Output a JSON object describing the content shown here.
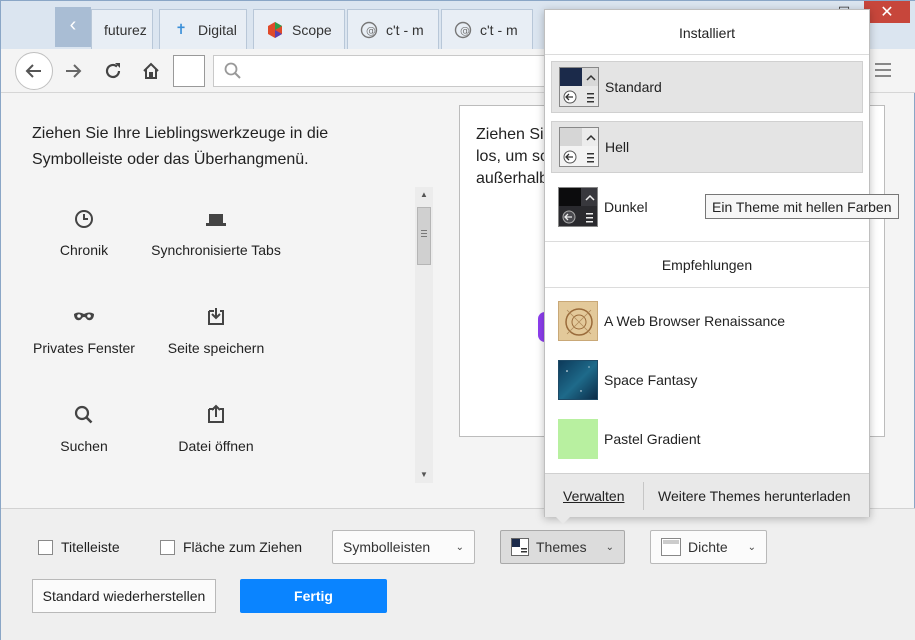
{
  "tabs": [
    {
      "label": "futurez",
      "icon": "future-favicon"
    },
    {
      "label": "Digital",
      "icon": "cross-favicon"
    },
    {
      "label": "Scope",
      "icon": "hexagon-favicon"
    },
    {
      "label": "c't - m",
      "icon": "heise-favicon"
    },
    {
      "label": "c't - m",
      "icon": "heise-favicon"
    }
  ],
  "customize": {
    "intro": "Ziehen Sie Ihre Lieblingswerkzeuge in die Symbolleiste oder das Überhangmenü.",
    "items": [
      {
        "label": "Chronik",
        "icon": "clock-icon"
      },
      {
        "label": "Synchronisierte Tabs",
        "icon": "laptop-icon"
      },
      {
        "label": "Privates Fenster",
        "icon": "mask-icon"
      },
      {
        "label": "Seite speichern",
        "icon": "save-page-icon"
      },
      {
        "label": "Suchen",
        "icon": "search-icon"
      },
      {
        "label": "Datei öffnen",
        "icon": "open-file-icon"
      }
    ],
    "overflow_text_line1": "Ziehen Si",
    "overflow_text_line2": "los, um sc",
    "overflow_text_line3": "außerhalb"
  },
  "bottom": {
    "titlebar_label": "Titelleiste",
    "dragspace_label": "Fläche zum Ziehen",
    "toolbars_label": "Symbolleisten",
    "themes_label": "Themes",
    "density_label": "Dichte",
    "restore_label": "Standard wiederherstellen",
    "done_label": "Fertig"
  },
  "themes_popup": {
    "installed_header": "Installiert",
    "installed": [
      {
        "name": "Standard",
        "selected": true
      },
      {
        "name": "Hell",
        "selected": false
      },
      {
        "name": "Dunkel",
        "selected": false
      }
    ],
    "recommended_header": "Empfehlungen",
    "recommended": [
      {
        "name": "A Web Browser Renaissance",
        "color": "#d8b98a"
      },
      {
        "name": "Space Fantasy",
        "color": "#1e5a7a"
      },
      {
        "name": "Pastel Gradient",
        "color": "#b8f0a0"
      }
    ],
    "manage_label": "Verwalten",
    "more_label": "Weitere Themes herunterladen"
  },
  "tooltip": "Ein Theme mit hellen Farben",
  "colors": {
    "accent": "#0a84ff",
    "close": "#c7463b"
  }
}
